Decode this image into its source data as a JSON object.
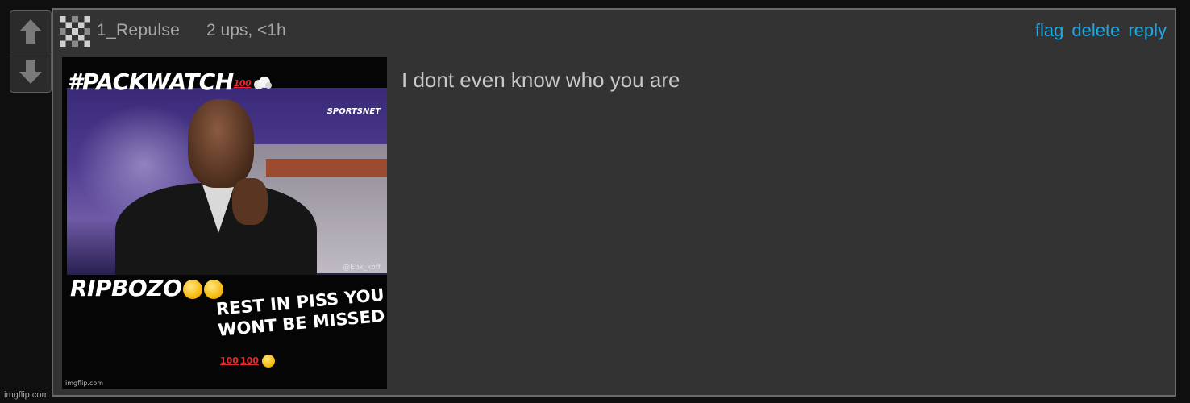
{
  "vote": {
    "upvote_icon": "arrow-up-icon",
    "downvote_icon": "arrow-down-icon"
  },
  "comment": {
    "avatar_icon": "checker-avatar-icon",
    "username": "1_Repulse",
    "meta": "2 ups, <1h",
    "actions": {
      "flag": "flag",
      "delete": "delete",
      "reply": "reply"
    },
    "text": "I dont even know who you are"
  },
  "meme": {
    "hashtag": "#PACKWATCH",
    "network_logo": "SPORTSNET",
    "handle": "@Ebk_koff",
    "top_caption": "RIPBOZO",
    "bottom_caption_line1": "REST IN PISS YOU",
    "bottom_caption_line2": "WONT BE MISSED",
    "watermark": "imgflip.com",
    "emoji_100": "100"
  },
  "site_watermark": "imgflip.com",
  "colors": {
    "link": "#21a9e1",
    "panel_bg": "#333333",
    "page_bg": "#0f0f0f"
  }
}
